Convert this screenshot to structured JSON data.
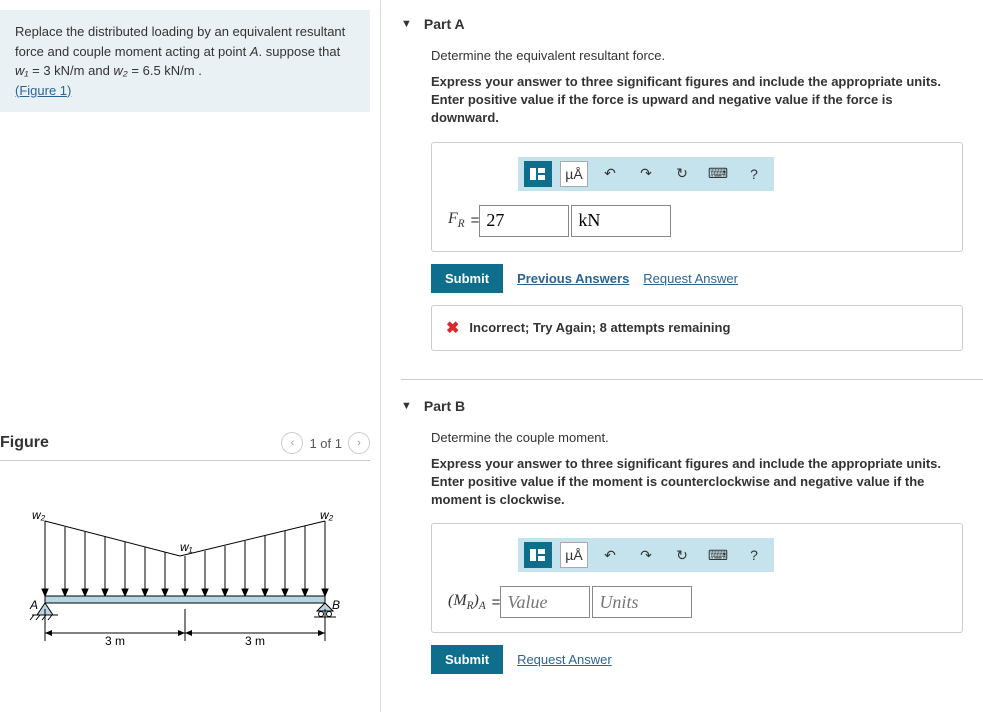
{
  "problem": {
    "text_pre": "Replace the distributed loading by an equivalent resultant force and couple moment acting at point ",
    "point": "A",
    "text_mid": ". suppose that ",
    "w1_var": "w₁",
    "w1_val": " = 3  kN/m",
    "and": " and ",
    "w2_var": "w₂",
    "w2_val": " = 6.5  kN/m .",
    "figure_link": "(Figure 1)"
  },
  "figure": {
    "title": "Figure",
    "pager": "1 of 1",
    "labels": {
      "w1": "w₁",
      "w2": "w₂",
      "A": "A",
      "B": "B",
      "d1": "3 m",
      "d2": "3 m"
    }
  },
  "partA": {
    "title": "Part A",
    "desc": "Determine the equivalent resultant force.",
    "instr": "Express your answer to three significant figures and include the appropriate units. Enter positive value if the force is upward and negative value if the force is downward.",
    "var_label_html": "F",
    "var_sub": "R",
    "equals": " = ",
    "value": "27",
    "unit": "kN",
    "toolbar": {
      "ua": "µÅ",
      "help": "?"
    },
    "submit": "Submit",
    "prev": "Previous Answers",
    "request": "Request Answer",
    "feedback": "Incorrect; Try Again; 8 attempts remaining"
  },
  "partB": {
    "title": "Part B",
    "desc": "Determine the couple moment.",
    "instr": "Express your answer to three significant figures and include the appropriate units. Enter positive value if the moment is counterclockwise and negative value if the moment is clockwise.",
    "var_label": "(M",
    "var_sub": "R",
    "var_label2": ")",
    "var_sub2": "A",
    "equals": " = ",
    "value_ph": "Value",
    "unit_ph": "Units",
    "toolbar": {
      "ua": "µÅ",
      "help": "?"
    },
    "submit": "Submit",
    "request": "Request Answer"
  }
}
